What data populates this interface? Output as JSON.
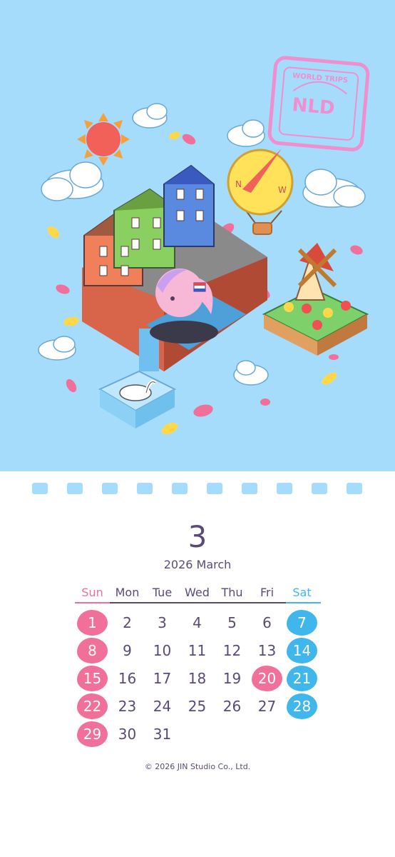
{
  "illustration": {
    "stamp_top_text": "WORLD TRIPS",
    "stamp_code": "NLD",
    "compass_n": "N",
    "compass_w": "W"
  },
  "calendar": {
    "month_number": "3",
    "month_title": "2026 March",
    "weekdays": [
      "Sun",
      "Mon",
      "Tue",
      "Wed",
      "Thu",
      "Fri",
      "Sat"
    ],
    "colors": {
      "sunday": "#f07099",
      "saturday": "#3fb6ec",
      "text": "#5a4a78",
      "sky": "#a6dcfb"
    },
    "days": [
      "1",
      "2",
      "3",
      "4",
      "5",
      "6",
      "7",
      "8",
      "9",
      "10",
      "11",
      "12",
      "13",
      "14",
      "15",
      "16",
      "17",
      "18",
      "19",
      "20",
      "21",
      "22",
      "23",
      "24",
      "25",
      "26",
      "27",
      "28",
      "29",
      "30",
      "31"
    ],
    "first_weekday_index": 0,
    "holidays": [
      "20"
    ]
  },
  "footer": {
    "copyright": "© 2026 JIN Studio Co., Ltd."
  }
}
